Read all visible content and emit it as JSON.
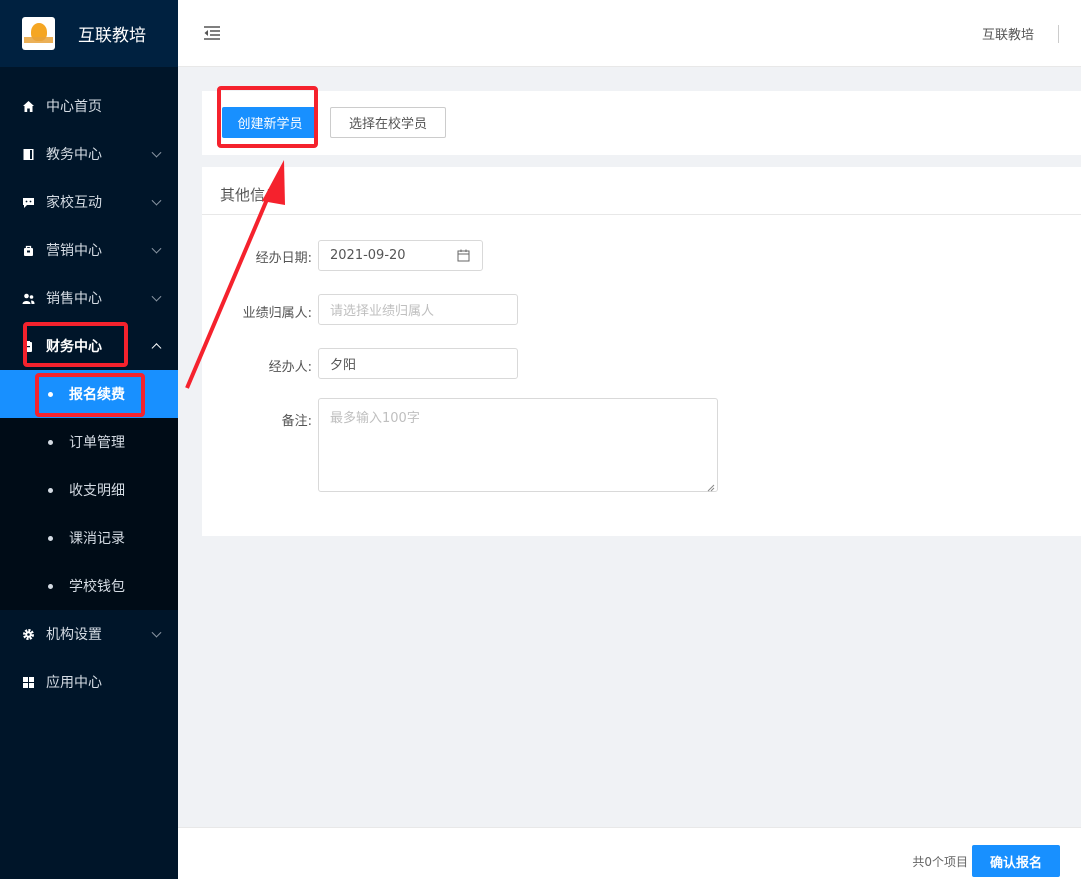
{
  "brand": {
    "name": "互联教培",
    "logo_icon": "lightbulb-logo-icon"
  },
  "sidebar": {
    "items": [
      {
        "label": "中心首页",
        "icon": "home-icon"
      },
      {
        "label": "教务中心",
        "icon": "book-icon"
      },
      {
        "label": "家校互动",
        "icon": "chat-icon"
      },
      {
        "label": "营销中心",
        "icon": "bag-icon"
      },
      {
        "label": "销售中心",
        "icon": "users-icon"
      },
      {
        "label": "财务中心",
        "icon": "wallet-icon"
      },
      {
        "label": "机构设置",
        "icon": "gear-icon"
      },
      {
        "label": "应用中心",
        "icon": "grid-icon"
      }
    ],
    "finance_sub": [
      {
        "label": "报名续费"
      },
      {
        "label": "订单管理"
      },
      {
        "label": "收支明细"
      },
      {
        "label": "课消记录"
      },
      {
        "label": "学校钱包"
      }
    ]
  },
  "header": {
    "org": "互联教培"
  },
  "toolbar": {
    "create_label": "创建新学员",
    "select_label": "选择在校学员"
  },
  "form": {
    "section_title": "其他信息",
    "date_label": "经办日期:",
    "date_value": "2021-09-20",
    "owner_label": "业绩归属人:",
    "owner_placeholder": "请选择业绩归属人",
    "handler_label": "经办人:",
    "handler_value": "夕阳",
    "note_label": "备注:",
    "note_placeholder": "最多输入100字"
  },
  "footer": {
    "count_text": "共0个项目",
    "confirm_label": "确认报名"
  },
  "colors": {
    "primary": "#1890ff",
    "sidebar_bg": "#001529",
    "annotation": "#f5222d"
  }
}
